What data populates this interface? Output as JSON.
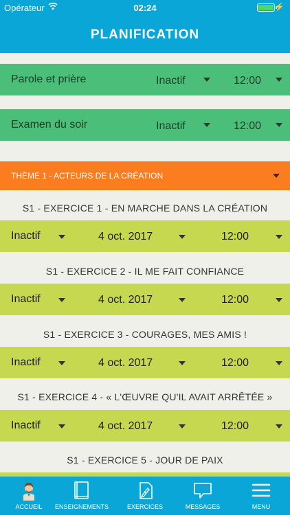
{
  "status_bar": {
    "carrier": "Opérateur",
    "time": "02:24"
  },
  "header": {
    "title": "PLANIFICATION"
  },
  "prayers": [
    {
      "name": "Parole et prière",
      "status": "Inactif",
      "time": "12:00"
    },
    {
      "name": "Examen du soir",
      "status": "Inactif",
      "time": "12:00"
    }
  ],
  "theme": {
    "label": "THÈME 1 - ACTEURS DE LA CRÉATION"
  },
  "exercises": [
    {
      "title": "S1 - EXERCICE 1 - EN MARCHE DANS LA CRÉATION",
      "status": "Inactif",
      "date": "4 oct. 2017",
      "time": "12:00"
    },
    {
      "title": "S1 - EXERCICE 2 - IL ME FAIT CONFIANCE",
      "status": "Inactif",
      "date": "4 oct. 2017",
      "time": "12:00"
    },
    {
      "title": "S1 - EXERCICE 3 - COURAGES, MES AMIS !",
      "status": "Inactif",
      "date": "4 oct. 2017",
      "time": "12:00"
    },
    {
      "title": "S1 - EXERCICE 4 - « L'ŒUVRE QU'IL AVAIT ARRÊTÉE »",
      "status": "Inactif",
      "date": "4 oct. 2017",
      "time": "12:00"
    },
    {
      "title": "S1 - EXERCICE 5 - JOUR DE PAIX"
    }
  ],
  "tabs": [
    {
      "label": "ACCUEIL",
      "icon": "person-avatar-icon"
    },
    {
      "label": "ENSEIGNEMENTS",
      "icon": "book-icon"
    },
    {
      "label": "EXERCICES",
      "icon": "pen-document-icon"
    },
    {
      "label": "MESSAGES",
      "icon": "speech-bubble-icon"
    },
    {
      "label": "MENU",
      "icon": "hamburger-menu-icon"
    }
  ],
  "colors": {
    "header": "#0aa6d7",
    "prayer_row": "#4bbe7a",
    "theme_row": "#fb7d1f",
    "exercise_row": "#c5d84f",
    "background": "#f0f0eb"
  }
}
